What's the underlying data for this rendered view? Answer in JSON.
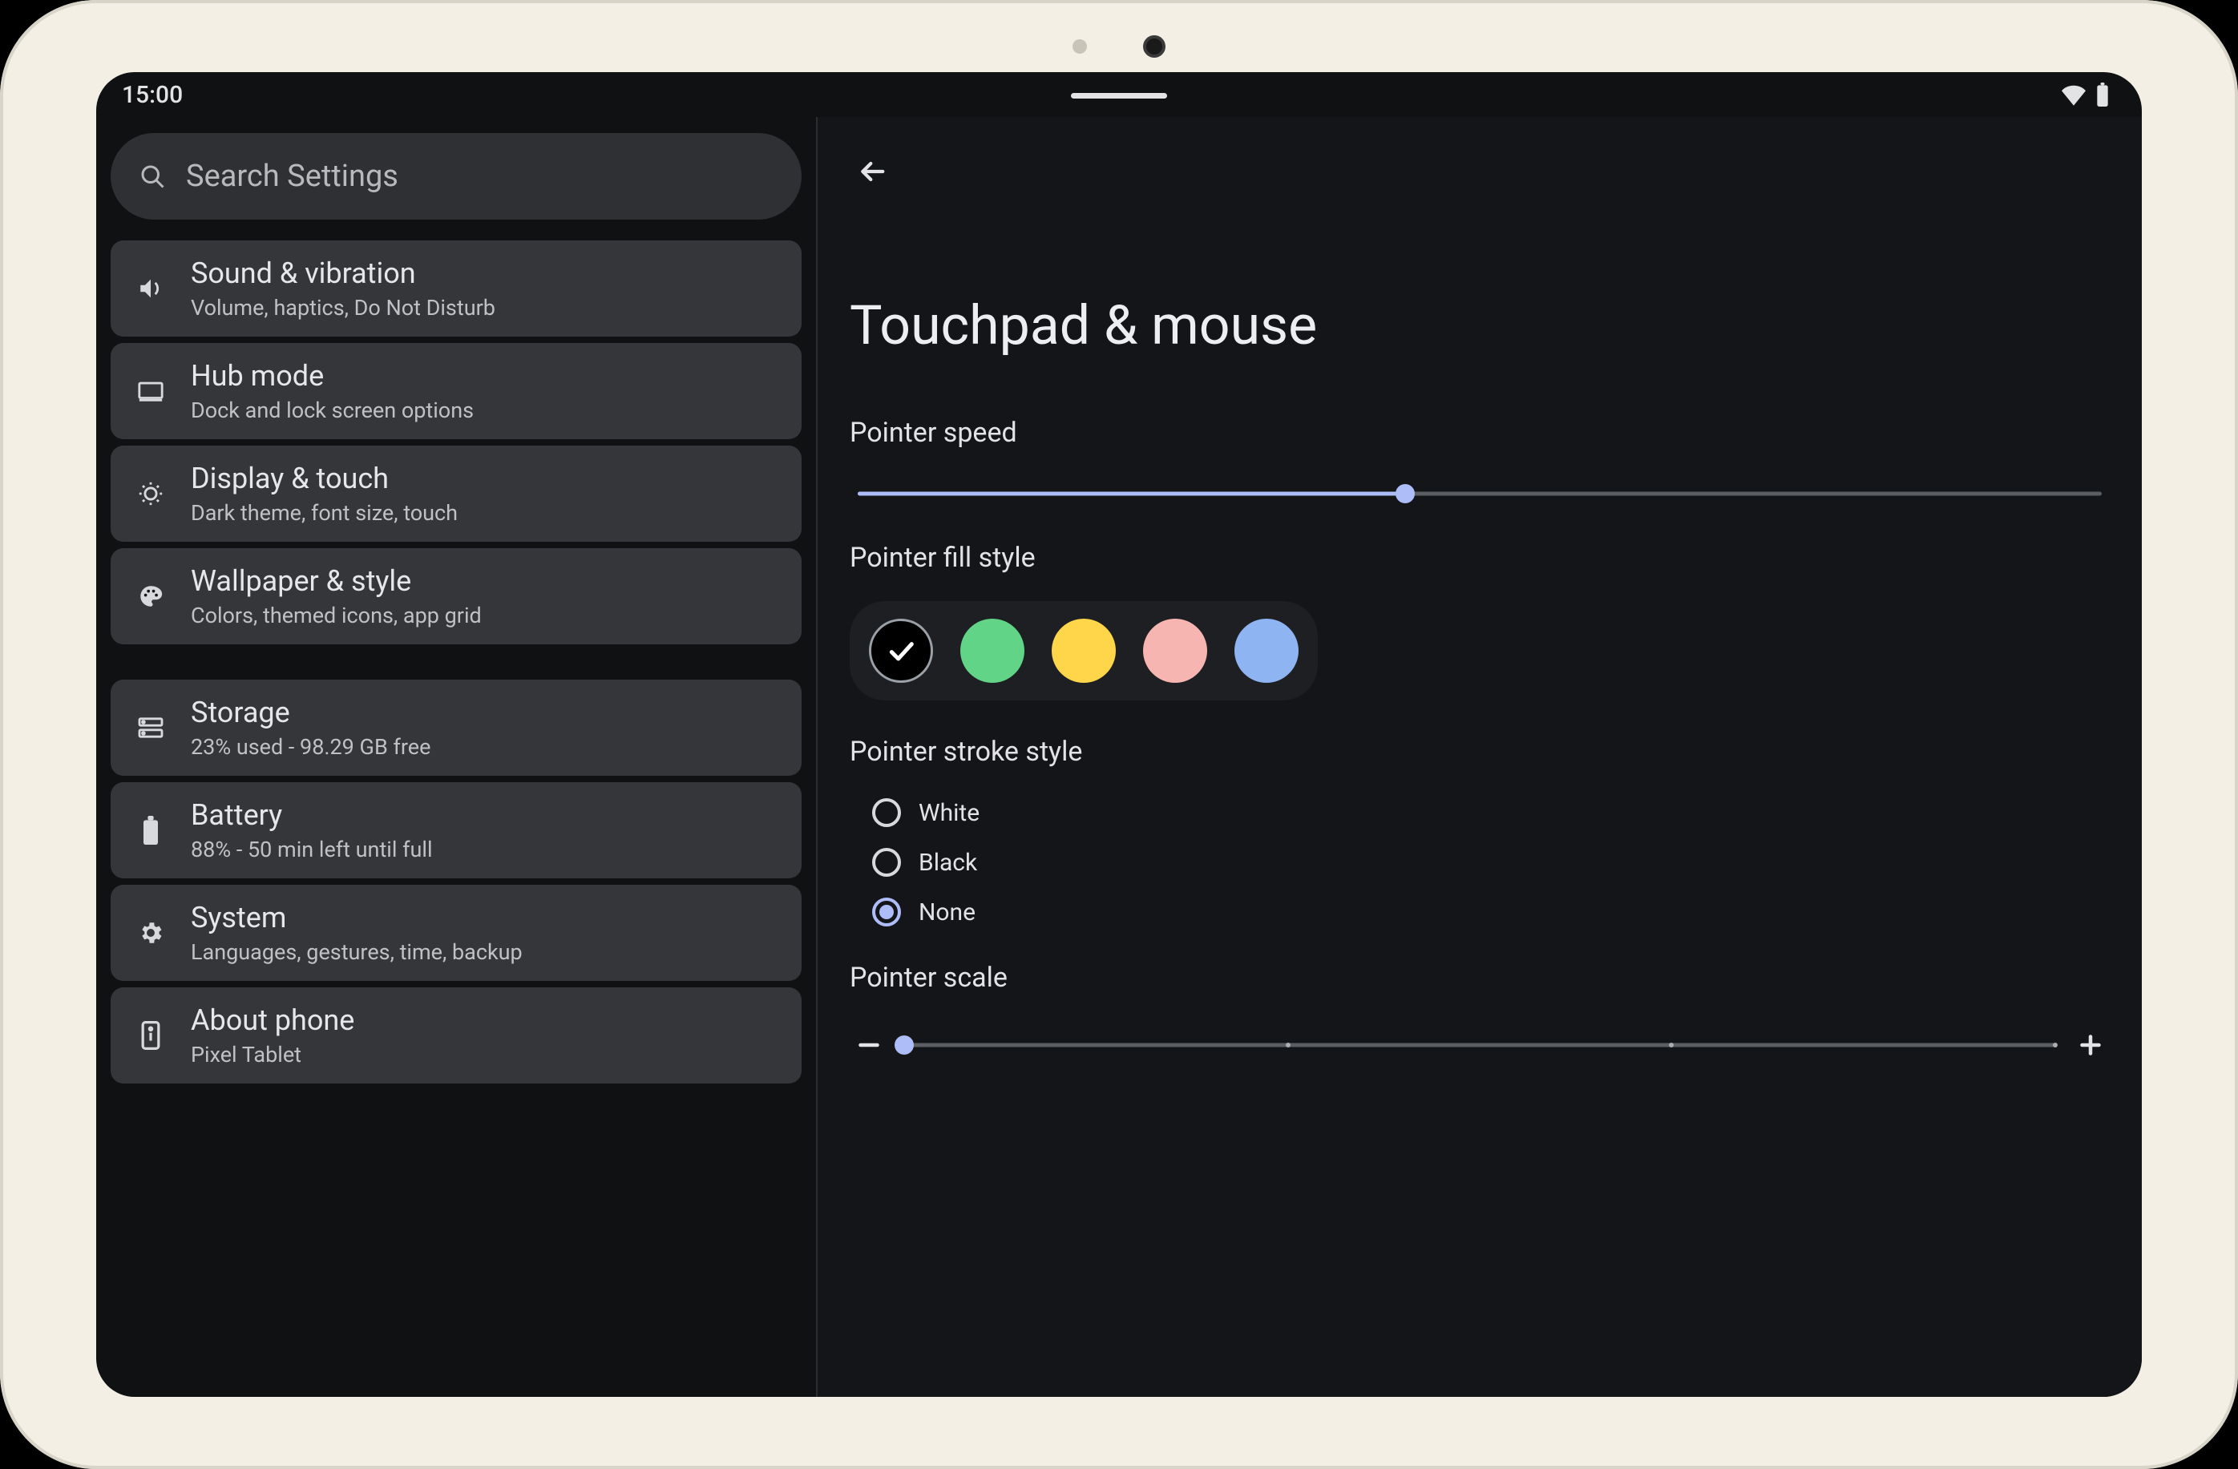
{
  "statusbar": {
    "time": "15:00"
  },
  "search": {
    "placeholder": "Search Settings"
  },
  "sidebar": {
    "group1": [
      {
        "title": "Sound & vibration",
        "sub": "Volume, haptics, Do Not Disturb"
      },
      {
        "title": "Hub mode",
        "sub": "Dock and lock screen options"
      },
      {
        "title": "Display & touch",
        "sub": "Dark theme, font size, touch"
      },
      {
        "title": "Wallpaper & style",
        "sub": "Colors, themed icons, app grid"
      }
    ],
    "group2": [
      {
        "title": "Storage",
        "sub": "23% used - 98.29 GB free"
      },
      {
        "title": "Battery",
        "sub": "88% - 50 min left until full"
      },
      {
        "title": "System",
        "sub": "Languages, gestures, time, backup"
      },
      {
        "title": "About phone",
        "sub": "Pixel Tablet"
      }
    ]
  },
  "page": {
    "title": "Touchpad & mouse",
    "speed_label": "Pointer speed",
    "fill_label": "Pointer fill style",
    "stroke_label": "Pointer stroke style",
    "scale_label": "Pointer scale"
  },
  "pointer_speed": {
    "percent": 44
  },
  "fill_colors": {
    "selected_index": 0,
    "options": [
      "#000000",
      "#62d487",
      "#ffd54a",
      "#f7b5b2",
      "#8fb4f2"
    ]
  },
  "stroke": {
    "options": [
      "White",
      "Black",
      "None"
    ],
    "selected_index": 2
  },
  "scale": {
    "steps": 4,
    "value_index": 0
  },
  "colors": {
    "accent": "#aebcf8"
  }
}
